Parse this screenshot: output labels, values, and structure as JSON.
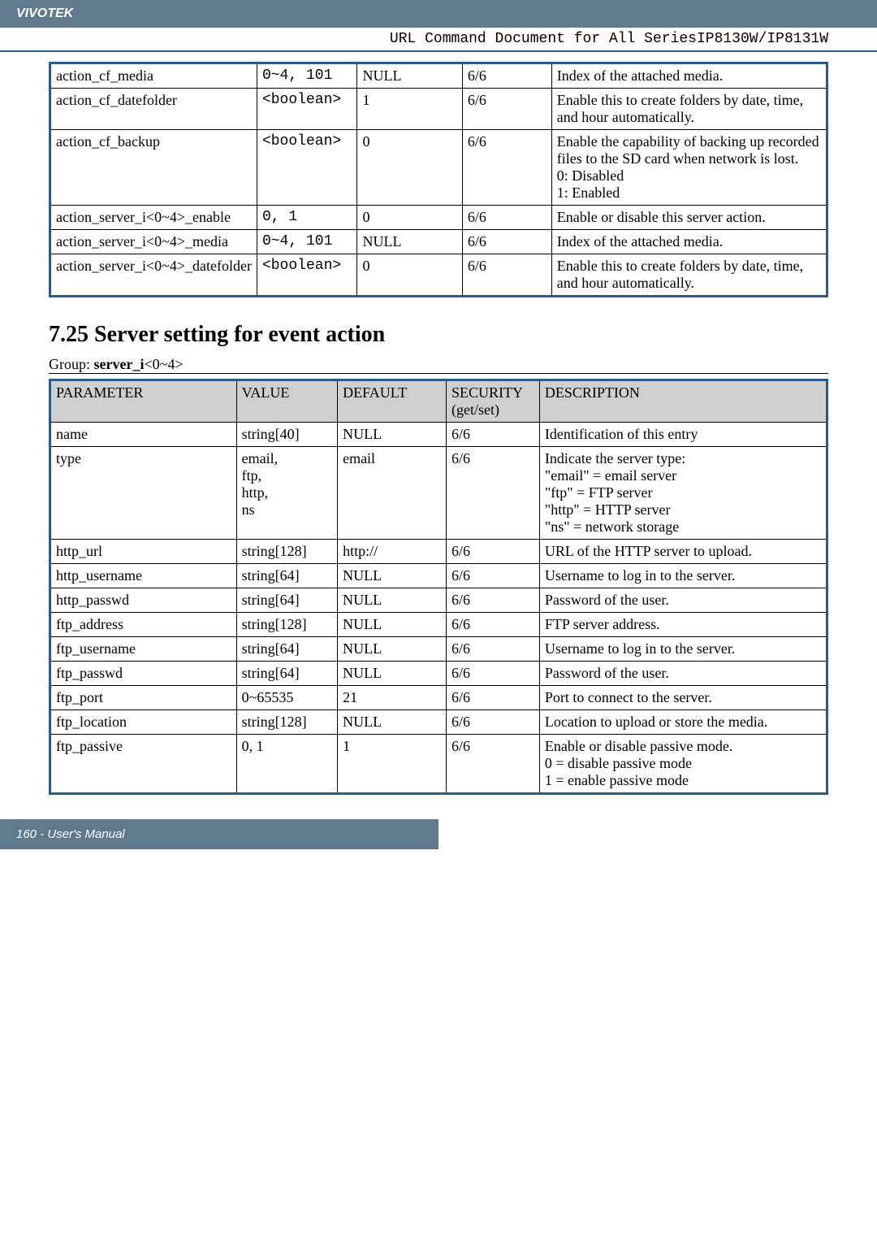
{
  "header": {
    "brand": "VIVOTEK"
  },
  "doc_title": "URL Command Document for All SeriesIP8130W/IP8131W",
  "table1": {
    "rows": [
      {
        "param": "action_cf_media",
        "value": "0~4, 101",
        "default": "NULL",
        "security": "6/6",
        "desc": "Index of the attached media."
      },
      {
        "param": "action_cf_datefolder",
        "value": "<boolean>",
        "default": "1",
        "security": "6/6",
        "desc": "Enable this to create folders by date, time, and hour automatically."
      },
      {
        "param": "action_cf_backup",
        "value": "<boolean>",
        "default": "0",
        "security": "6/6",
        "desc": "Enable the capability of backing up recorded files to the SD card when network is lost.\n0: Disabled\n1: Enabled"
      },
      {
        "param": "action_server_i<0~4>_enable",
        "value": "0, 1",
        "default": "0",
        "security": "6/6",
        "desc": "Enable or disable this server action."
      },
      {
        "param": "action_server_i<0~4>_media",
        "value": "0~4, 101",
        "default": "NULL",
        "security": "6/6",
        "desc": "Index of the attached media."
      },
      {
        "param": "action_server_i<0~4>_datefolder",
        "value": "<boolean>",
        "default": "0",
        "security": "6/6",
        "desc": "Enable this to create folders by date, time, and hour automatically."
      }
    ]
  },
  "section_heading": "7.25 Server setting for event action",
  "group_label_prefix": "Group: ",
  "group_label_bold": "server_i",
  "group_label_suffix": "<0~4>",
  "table2": {
    "headers": {
      "param": "PARAMETER",
      "value": "VALUE",
      "default": "DEFAULT",
      "security": "SECURITY (get/set)",
      "desc": "DESCRIPTION"
    },
    "rows": [
      {
        "param": "name",
        "value": "string[40]",
        "default": "NULL",
        "security": "6/6",
        "desc": "Identification of this entry"
      },
      {
        "param": "type",
        "value": "email,\nftp,\nhttp,\nns",
        "default": "email",
        "security": "6/6",
        "desc": "Indicate the server type:\n\"email\" = email server\n\"ftp\" = FTP server\n\"http\" = HTTP server\n\"ns\" = network storage"
      },
      {
        "param": "http_url",
        "value": "string[128]",
        "default": "http://",
        "security": "6/6",
        "desc": "URL of the HTTP server to upload."
      },
      {
        "param": "http_username",
        "value": "string[64]",
        "default": "NULL",
        "security": "6/6",
        "desc": "Username to log in to the server."
      },
      {
        "param": "http_passwd",
        "value": "string[64]",
        "default": "NULL",
        "security": "6/6",
        "desc": "Password of the user."
      },
      {
        "param": "ftp_address",
        "value": "string[128]",
        "default": "NULL",
        "security": "6/6",
        "desc": "FTP server address."
      },
      {
        "param": "ftp_username",
        "value": "string[64]",
        "default": "NULL",
        "security": "6/6",
        "desc": "Username to log in to the server."
      },
      {
        "param": "ftp_passwd",
        "value": "string[64]",
        "default": "NULL",
        "security": "6/6",
        "desc": "Password of the user."
      },
      {
        "param": "ftp_port",
        "value": "0~65535",
        "default": "21",
        "security": "6/6",
        "desc": "Port to connect to the server."
      },
      {
        "param": "ftp_location",
        "value": "string[128]",
        "default": "NULL",
        "security": "6/6",
        "desc": "Location to upload or store the media."
      },
      {
        "param": "ftp_passive",
        "value": "0, 1",
        "default": "1",
        "security": "6/6",
        "desc": "Enable or disable passive mode.\n0 = disable passive mode\n1 = enable passive mode"
      }
    ]
  },
  "footer": "160 - User's Manual"
}
